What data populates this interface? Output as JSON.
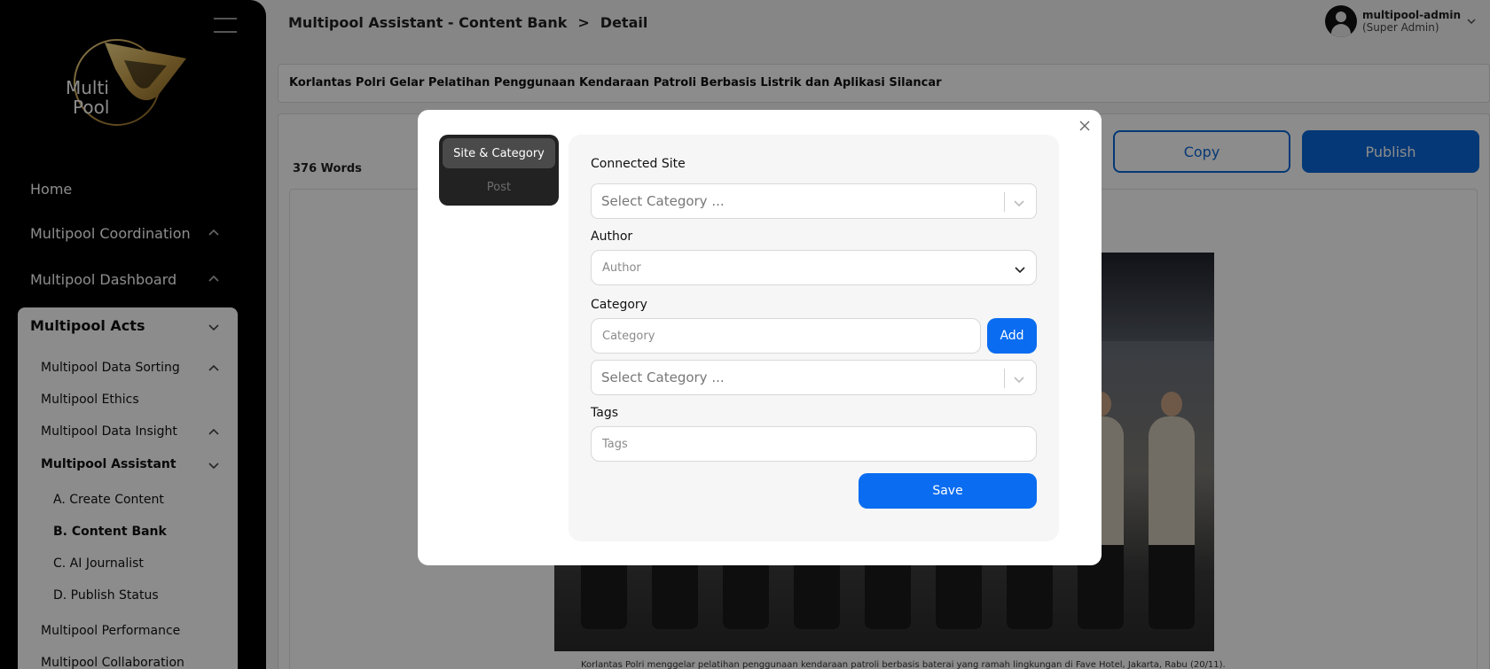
{
  "sidebar": {
    "logo_text_line1": "Multi",
    "logo_text_line2": "Pool",
    "items": [
      {
        "label": "Home"
      },
      {
        "label": "Multipool Coordination"
      },
      {
        "label": "Multipool Dashboard"
      },
      {
        "label": "Multipool Acts"
      }
    ],
    "acts_children": [
      {
        "label": "Multipool Data Sorting"
      },
      {
        "label": "Multipool Ethics"
      },
      {
        "label": "Multipool Data Insight"
      },
      {
        "label": "Multipool Assistant"
      },
      {
        "label": "A. Create Content"
      },
      {
        "label": "B. Content Bank"
      },
      {
        "label": "C. AI Journalist"
      },
      {
        "label": "D. Publish Status"
      },
      {
        "label": "Multipool Performance"
      },
      {
        "label": "Multipool Collaboration"
      }
    ]
  },
  "header": {
    "breadcrumb_parent": "Multipool Assistant - Content Bank",
    "breadcrumb_separator": ">",
    "breadcrumb_current": "Detail",
    "user_name": "multipool-admin",
    "user_role": "(Super Admin)"
  },
  "article": {
    "title": "Korlantas Polri Gelar Pelatihan Penggunaan Kendaraan Patroli Berbasis Listrik dan Aplikasi Silancar",
    "word_count": "376 Words",
    "copy_label": "Copy",
    "publish_label": "Publish",
    "caption": "Korlantas Polri menggelar pelatihan penggunaan kendaraan patroli berbasis baterai yang ramah lingkungan di Fave Hotel, Jakarta, Rabu (20/11)."
  },
  "modal": {
    "tabs": [
      {
        "label": "Site & Category",
        "active": true
      },
      {
        "label": "Post",
        "active": false
      }
    ],
    "connected_site_label": "Connected Site",
    "connected_site_placeholder": "Select Category ...",
    "author_label": "Author",
    "author_placeholder": "Author",
    "category_label": "Category",
    "category_placeholder": "Category",
    "add_label": "Add",
    "category_select_placeholder": "Select Category ...",
    "tags_label": "Tags",
    "tags_placeholder": "Tags",
    "save_label": "Save"
  },
  "colors": {
    "accent": "#0a6cf0",
    "sidebar_bg": "#000000",
    "logo_gold": "#c9a04a"
  }
}
